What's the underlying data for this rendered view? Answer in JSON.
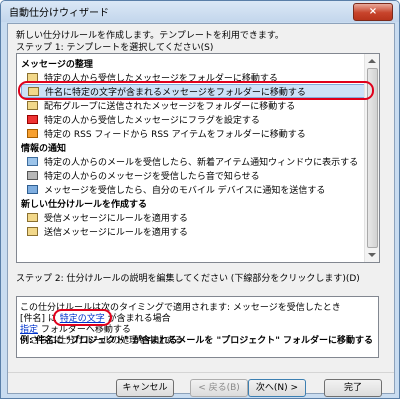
{
  "window": {
    "title": "自動仕分けウィザード",
    "close_label": "×"
  },
  "intro_text": "新しい仕分けルールを作成します。テンプレートを利用できます。",
  "step1_label": "ステップ 1: テンプレートを選択してください(S)",
  "groups": [
    {
      "title": "メッセージの整理"
    },
    {
      "title": "情報の通知"
    },
    {
      "title": "新しい仕分けルールを作成する"
    }
  ],
  "items": [
    {
      "label": "特定の人から受信したメッセージをフォルダーに移動する",
      "icon": "folder-move-icon",
      "selected": false
    },
    {
      "label": "件名に特定の文字が含まれるメッセージをフォルダーに移動する",
      "icon": "folder-move-icon",
      "selected": true
    },
    {
      "label": "配布グループに送信されたメッセージをフォルダーに移動する",
      "icon": "folder-move-icon",
      "selected": false
    },
    {
      "label": "特定の人から受信したメッセージにフラグを設定する",
      "icon": "flag-icon",
      "selected": false
    },
    {
      "label": "特定の RSS フィードから RSS アイテムをフォルダーに移動する",
      "icon": "rss-icon",
      "selected": false
    },
    {
      "label": "特定の人からのメールを受信したら、新着アイテム通知ウィンドウに表示する",
      "icon": "notify-icon",
      "selected": false
    },
    {
      "label": "特定の人からのメッセージを受信したら音で知らせる",
      "icon": "sound-icon",
      "selected": false
    },
    {
      "label": "メッセージを受信したら、自分のモバイル デバイスに通知を送信する",
      "icon": "mobile-icon",
      "selected": false
    },
    {
      "label": "受信メッセージにルールを適用する",
      "icon": "envelope-icon",
      "selected": false
    },
    {
      "label": "送信メッセージにルールを適用する",
      "icon": "envelope-icon",
      "selected": false
    }
  ],
  "step2_label": "ステップ 2: 仕分けルールの説明を編集してください (下線部分をクリックします)(D)",
  "description": {
    "line1": "この仕分けルールは次のタイミングで適用されます: メッセージを受信したとき",
    "line2_prefix": "[件名] に",
    "line2_link": "特定の文字",
    "line2_suffix": "が含まれる場合",
    "line3_link": "指定",
    "line3_suffix": " フォルダーへ移動する",
    "line4": "さらに仕分けルールの処理を中止する",
    "example": "例: 件名に \"プロジェクト\" が含まれるメールを \"プロジェクト\" フォルダーに移動する"
  },
  "buttons": {
    "cancel": "キャンセル",
    "back": "< 戻る(B)",
    "next": "次へ(N) >",
    "finish": "完了"
  },
  "colors": {
    "highlight": "#e0001b",
    "selection": "#cde2f8",
    "link": "#0033cc"
  }
}
